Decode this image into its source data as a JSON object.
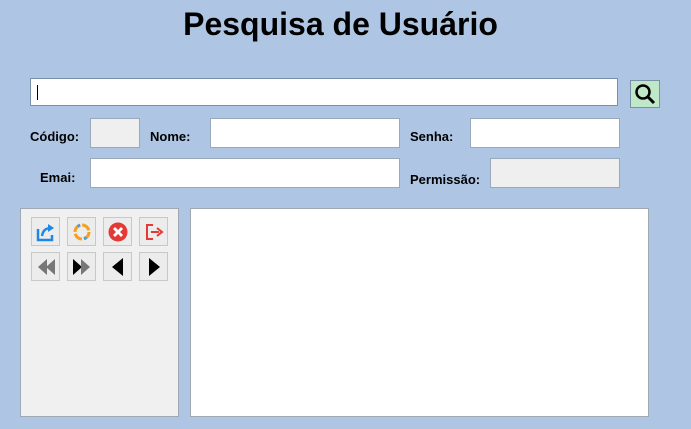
{
  "title": "Pesquisa de Usuário",
  "search": {
    "value": ""
  },
  "labels": {
    "codigo": "Código:",
    "nome": "Nome:",
    "senha": "Senha:",
    "email": "Emai:",
    "permissao": "Permissão:"
  },
  "fields": {
    "codigo": "",
    "nome": "",
    "senha": "",
    "email": "",
    "permissao": ""
  },
  "toolbar": {
    "icons": [
      "export-icon",
      "refresh-icon",
      "delete-icon",
      "exit-icon",
      "first-record-icon",
      "last-record-icon",
      "previous-record-icon",
      "next-record-icon"
    ]
  },
  "colors": {
    "background": "#aec6e4",
    "search_button": "#bfe8c8",
    "delete": "#e53935",
    "exit": "#e53935",
    "export": "#1e88e5",
    "refresh": "#f4a020"
  }
}
